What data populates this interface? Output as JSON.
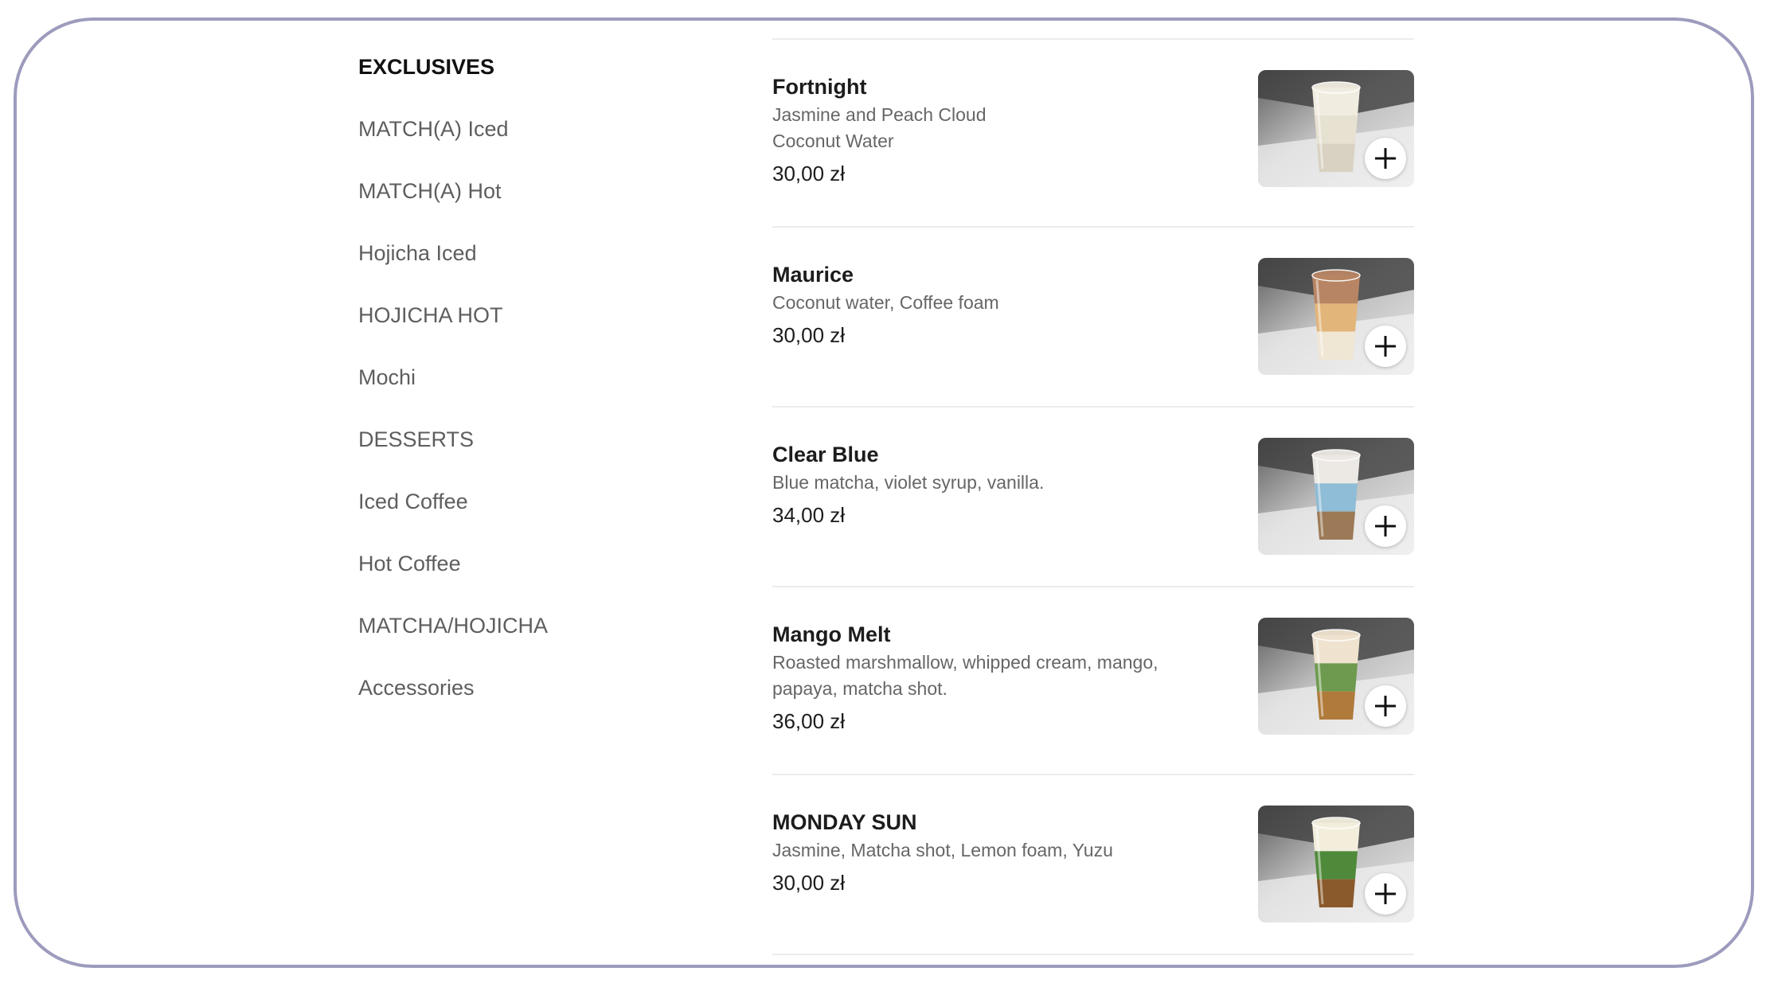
{
  "sidebar": {
    "items": [
      {
        "label": "EXCLUSIVES"
      },
      {
        "label": "MATCH(A) Iced"
      },
      {
        "label": "MATCH(A) Hot"
      },
      {
        "label": "Hojicha Iced"
      },
      {
        "label": "HOJICHA HOT"
      },
      {
        "label": "Mochi"
      },
      {
        "label": "DESSERTS"
      },
      {
        "label": "Iced Coffee"
      },
      {
        "label": "Hot Coffee"
      },
      {
        "label": "MATCHA/HOJICHA"
      },
      {
        "label": "Accessories"
      }
    ],
    "active": "EXCLUSIVES"
  },
  "menu": {
    "items": [
      {
        "name": "Fortnight",
        "description_lines": [
          "Jasmine and Peach Cloud",
          "Coconut Water"
        ],
        "price": "30,00 zł",
        "photo_icon": "iced-drink-photo",
        "drink_colors": [
          "#f1ece0",
          "#e7e1d2",
          "#d9d2c2"
        ]
      },
      {
        "name": "Maurice",
        "description_lines": [
          "Coconut water, Coffee foam"
        ],
        "price": "30,00 zł",
        "photo_icon": "iced-drink-photo",
        "drink_colors": [
          "#b88564",
          "#e2b57a",
          "#f0e6d4"
        ]
      },
      {
        "name": "Clear Blue",
        "description_lines": [
          "Blue matcha, violet syrup, vanilla."
        ],
        "price": "34,00 zł",
        "photo_icon": "iced-drink-photo",
        "drink_colors": [
          "#ece9e4",
          "#8fbcd6",
          "#9c7a57"
        ]
      },
      {
        "name": "Mango Melt",
        "description_lines": [
          "Roasted marshmallow, whipped cream, mango,",
          "papaya, matcha shot."
        ],
        "price": "36,00 zł",
        "photo_icon": "iced-drink-photo",
        "drink_colors": [
          "#efe3cf",
          "#6d9a4e",
          "#b07a3a"
        ]
      },
      {
        "name": "MONDAY SUN",
        "description_lines": [
          "Jasmine, Matcha shot, Lemon foam, Yuzu"
        ],
        "price": "30,00 zł",
        "photo_icon": "iced-drink-photo",
        "drink_colors": [
          "#f3eedc",
          "#4f8a3a",
          "#8a5a2c"
        ]
      }
    ],
    "add_button_icon": "plus-icon"
  }
}
